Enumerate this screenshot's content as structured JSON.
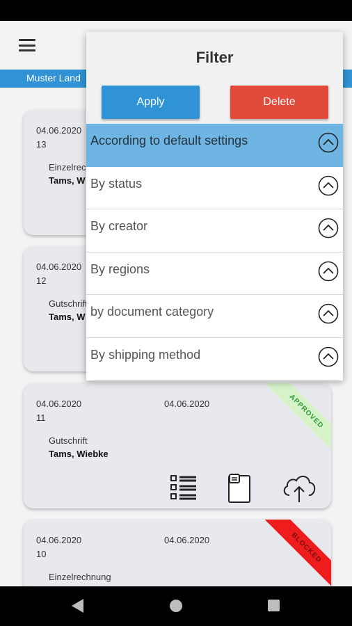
{
  "header": {
    "subtitle": "Muster Land"
  },
  "cards": [
    {
      "date1": "04.06.2020",
      "number": "13",
      "type": "Einzelrech",
      "name": "Tams, W"
    },
    {
      "date1": "04.06.2020",
      "number": "12",
      "type": "Gutschrift",
      "name": "Tams, W"
    },
    {
      "date1": "04.06.2020",
      "date2": "04.06.2020",
      "number": "11",
      "type": "Gutschrift",
      "name": "Tams, Wiebke",
      "ribbon": "APPROVED"
    },
    {
      "date1": "04.06.2020",
      "date2": "04.06.2020",
      "number": "10",
      "type": "Einzelrechnung",
      "ribbon": "BLOCKED"
    }
  ],
  "filter": {
    "title": "Filter",
    "apply_label": "Apply",
    "delete_label": "Delete",
    "items": [
      {
        "label": "According to default settings"
      },
      {
        "label": "By status"
      },
      {
        "label": "By creator"
      },
      {
        "label": "By regions"
      },
      {
        "label": "by document category"
      },
      {
        "label": "By shipping method"
      }
    ]
  },
  "colors": {
    "accent": "#2f93d6",
    "delete": "#e24b3c",
    "active_row": "#6fb5e3",
    "approved": "#2e9b37",
    "blocked": "#ee1c1c"
  },
  "icons": [
    "menu-icon",
    "list-icon",
    "document-icon",
    "cloud-upload-icon",
    "chevron-up-icon",
    "back-icon",
    "home-icon",
    "recents-icon"
  ]
}
